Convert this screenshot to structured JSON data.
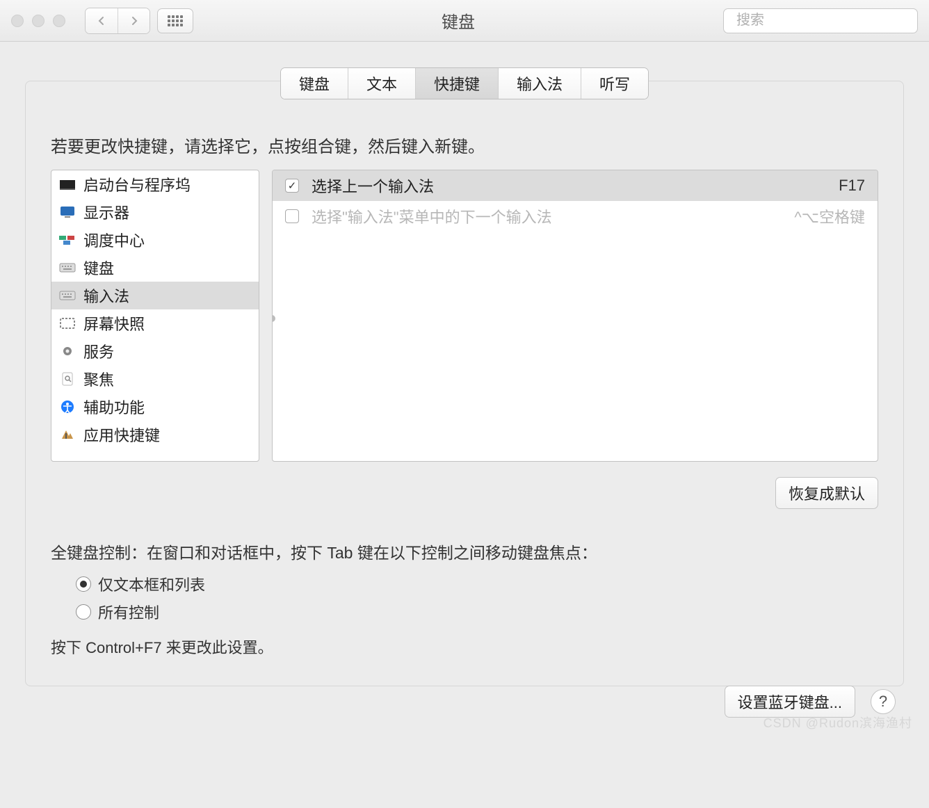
{
  "toolbar": {
    "title": "键盘",
    "search_placeholder": "搜索"
  },
  "tabs": [
    "键盘",
    "文本",
    "快捷键",
    "输入法",
    "听写"
  ],
  "active_tab_index": 2,
  "instruction": "若要更改快捷键，请选择它，点按组合键，然后键入新键。",
  "categories": [
    {
      "label": "启动台与程序坞",
      "icon": "launchpad"
    },
    {
      "label": "显示器",
      "icon": "display"
    },
    {
      "label": "调度中心",
      "icon": "mission"
    },
    {
      "label": "键盘",
      "icon": "keyboard"
    },
    {
      "label": "输入法",
      "icon": "keyboard",
      "selected": true
    },
    {
      "label": "屏幕快照",
      "icon": "screenshot"
    },
    {
      "label": "服务",
      "icon": "gear"
    },
    {
      "label": "聚焦",
      "icon": "spotlight"
    },
    {
      "label": "辅助功能",
      "icon": "accessibility"
    },
    {
      "label": "应用快捷键",
      "icon": "apps"
    }
  ],
  "shortcuts": [
    {
      "checked": true,
      "label": "选择上一个输入法",
      "key": "F17",
      "selected": true
    },
    {
      "checked": false,
      "label": "选择\"输入法\"菜单中的下一个输入法",
      "key": "^⌥空格键",
      "disabled": true
    }
  ],
  "restore_label": "恢复成默认",
  "full_kb": {
    "heading": "全键盘控制：在窗口和对话框中，按下 Tab 键在以下控制之间移动键盘焦点：",
    "options": [
      "仅文本框和列表",
      "所有控制"
    ],
    "selected": 0,
    "hint": "按下 Control+F7 来更改此设置。"
  },
  "bluetooth_label": "设置蓝牙键盘...",
  "watermark": "CSDN @Rudon滨海渔村"
}
